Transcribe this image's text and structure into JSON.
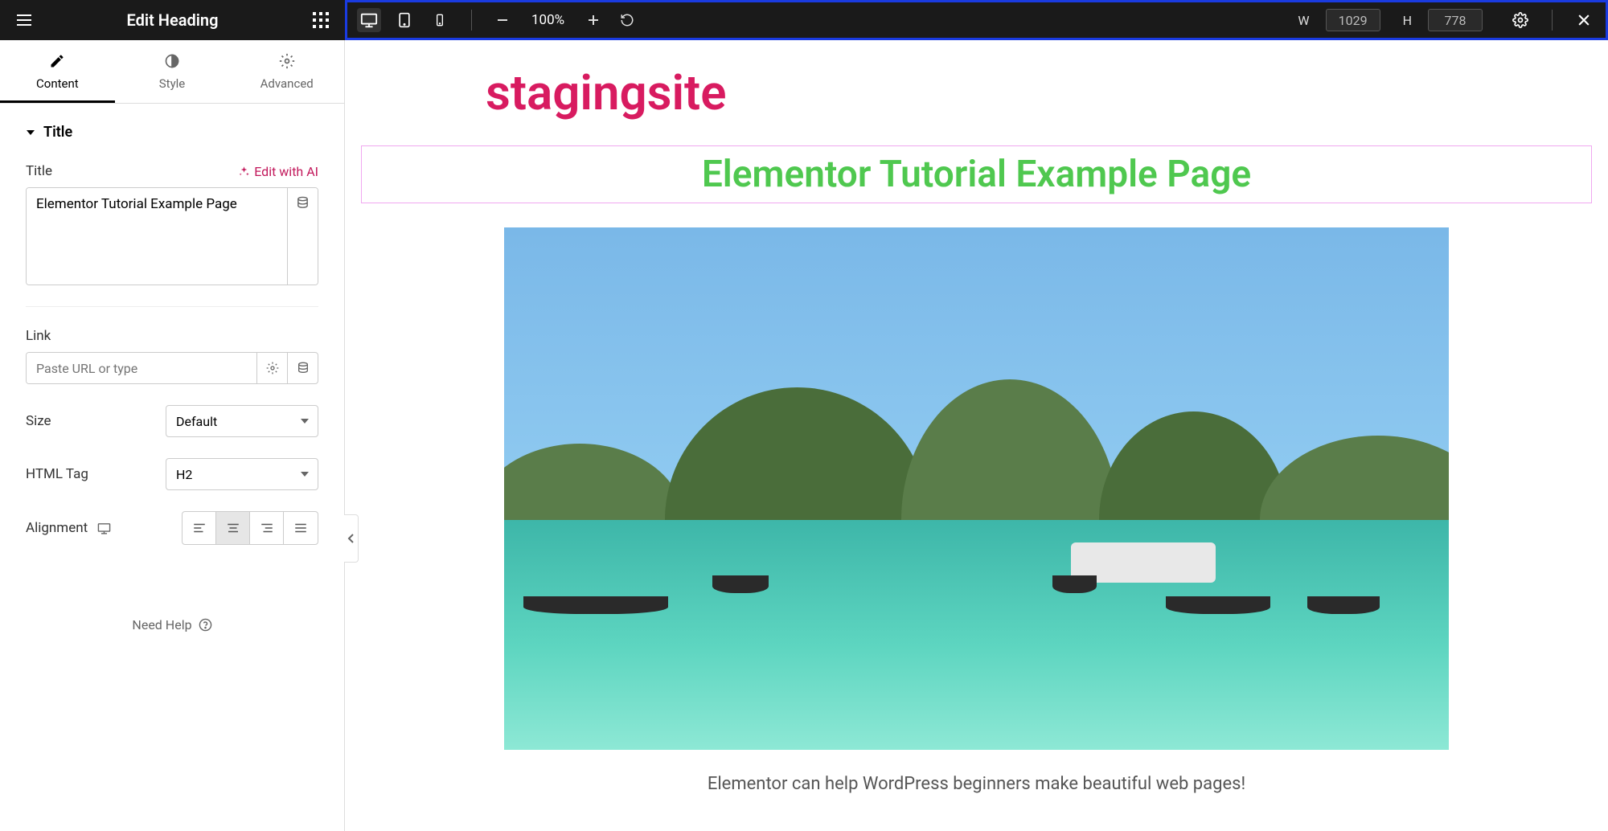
{
  "panel_title": "Edit Heading",
  "tabs": {
    "content": "Content",
    "style": "Style",
    "advanced": "Advanced"
  },
  "responsive": {
    "width_label": "W",
    "width": "1029",
    "height_label": "H",
    "height": "778",
    "zoom": "100%"
  },
  "section": {
    "title": "Title"
  },
  "controls": {
    "title_label": "Title",
    "edit_ai": "Edit with AI",
    "title_value": "Elementor Tutorial Example Page",
    "link_label": "Link",
    "link_placeholder": "Paste URL or type",
    "size_label": "Size",
    "size_value": "Default",
    "tag_label": "HTML Tag",
    "tag_value": "H2",
    "alignment_label": "Alignment"
  },
  "help": "Need Help",
  "preview": {
    "site_title": "stagingsite",
    "heading": "Elementor Tutorial Example Page",
    "caption": "Elementor can help WordPress beginners make beautiful web pages!"
  }
}
